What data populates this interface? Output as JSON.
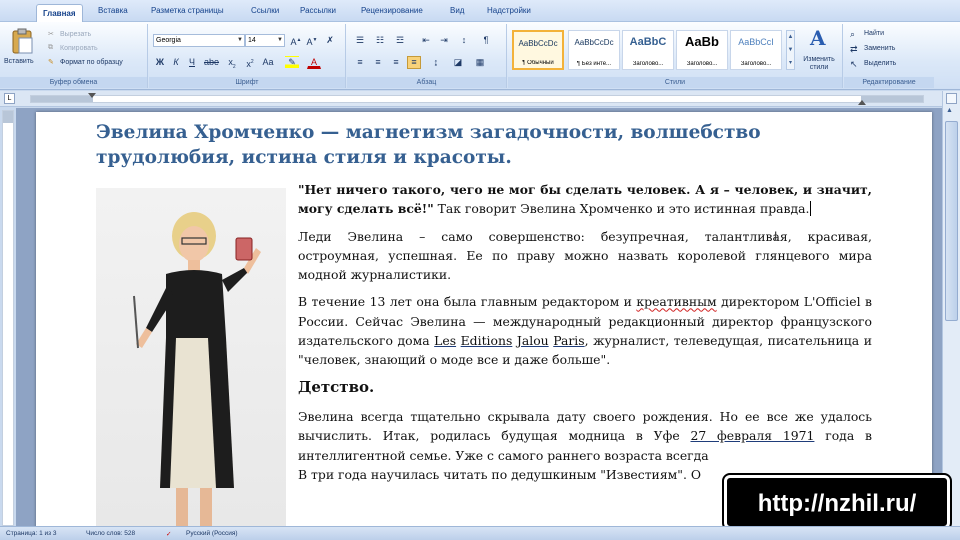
{
  "tabs": [
    "Главная",
    "Вставка",
    "Разметка страницы",
    "Ссылки",
    "Рассылки",
    "Рецензирование",
    "Вид",
    "Надстройки"
  ],
  "ribbon": {
    "clipboard": {
      "paste": "Вставить",
      "cut": "Вырезать",
      "copy": "Копировать",
      "format_painter": "Формат по образцу",
      "label": "Буфер обмена"
    },
    "font": {
      "name": "Georgia",
      "size": "14",
      "label": "Шрифт",
      "bold": "Ж",
      "italic": "К",
      "underline": "Ч"
    },
    "paragraph": {
      "label": "Абзац"
    },
    "styles": {
      "label": "Стили",
      "items": [
        {
          "preview": "AaBbCcDc",
          "name": "¶ Обычный"
        },
        {
          "preview": "AaBbCcDc",
          "name": "¶ Без инте..."
        },
        {
          "preview": "AaBbC",
          "name": "Заголово..."
        },
        {
          "preview": "AaBb",
          "name": "Заголово..."
        },
        {
          "preview": "AaBbCcI",
          "name": "Заголово..."
        }
      ],
      "change": "Изменить стили"
    },
    "editing": {
      "find": "Найти",
      "replace": "Заменить",
      "select": "Выделить",
      "label": "Редактирование"
    }
  },
  "document": {
    "title": "Эвелина Хромченко — магнетизм загадочности, волшебство трудолюбия, истина стиля и красоты.",
    "p1_bold": "\"Нет ничего такого, чего не мог бы сделать человек. А я – человек, и значит, могу сделать всё!\"",
    "p1_rest": " Так говорит Эвелина Хромченко и это истинная правда.",
    "p2": "Леди Эвелина – само совершенство: безупречная, талантливая, красивая, остроумная, успешная. Ее по праву можно назвать королевой глянцевого мира модной журналистики.",
    "p3_a": "В течение 13 лет она была главным редактором и ",
    "p3_creative": "креативным",
    "p3_b": " директором L'Officiel в России. Сейчас Эвелина — международный редакционный директор французского издательского дома ",
    "p3_les": "Les",
    "p3_editions": "Editions",
    "p3_jalou": "Jalou",
    "p3_paris": "Paris",
    "p3_c": ", журналист, телеведущая, писательница и \"человек, знающий о моде все и даже больше\".",
    "heading": "Детство.",
    "p4_a": "Эвелина всегда  тщательно скрывала дату своего рождения. Но ее все же удалось вычислить. Итак, родилась будущая модница в Уфе ",
    "p4_date": "27 февраля 1971",
    "p4_b": " года в интеллигентной семье. Уже с самого раннего возраста всегда",
    "p5": "В три года научилась читать по дедушкиным \"Известиям\". О"
  },
  "watermark": "http://nzhil.ru/",
  "status": {
    "page": "Страница: 1 из 3",
    "words": "Число слов: 528",
    "language": "Русский (Россия)"
  },
  "colors": {
    "title": "#366091",
    "ribbon_text": "#15428b",
    "style_selected": "#f3b23a"
  }
}
